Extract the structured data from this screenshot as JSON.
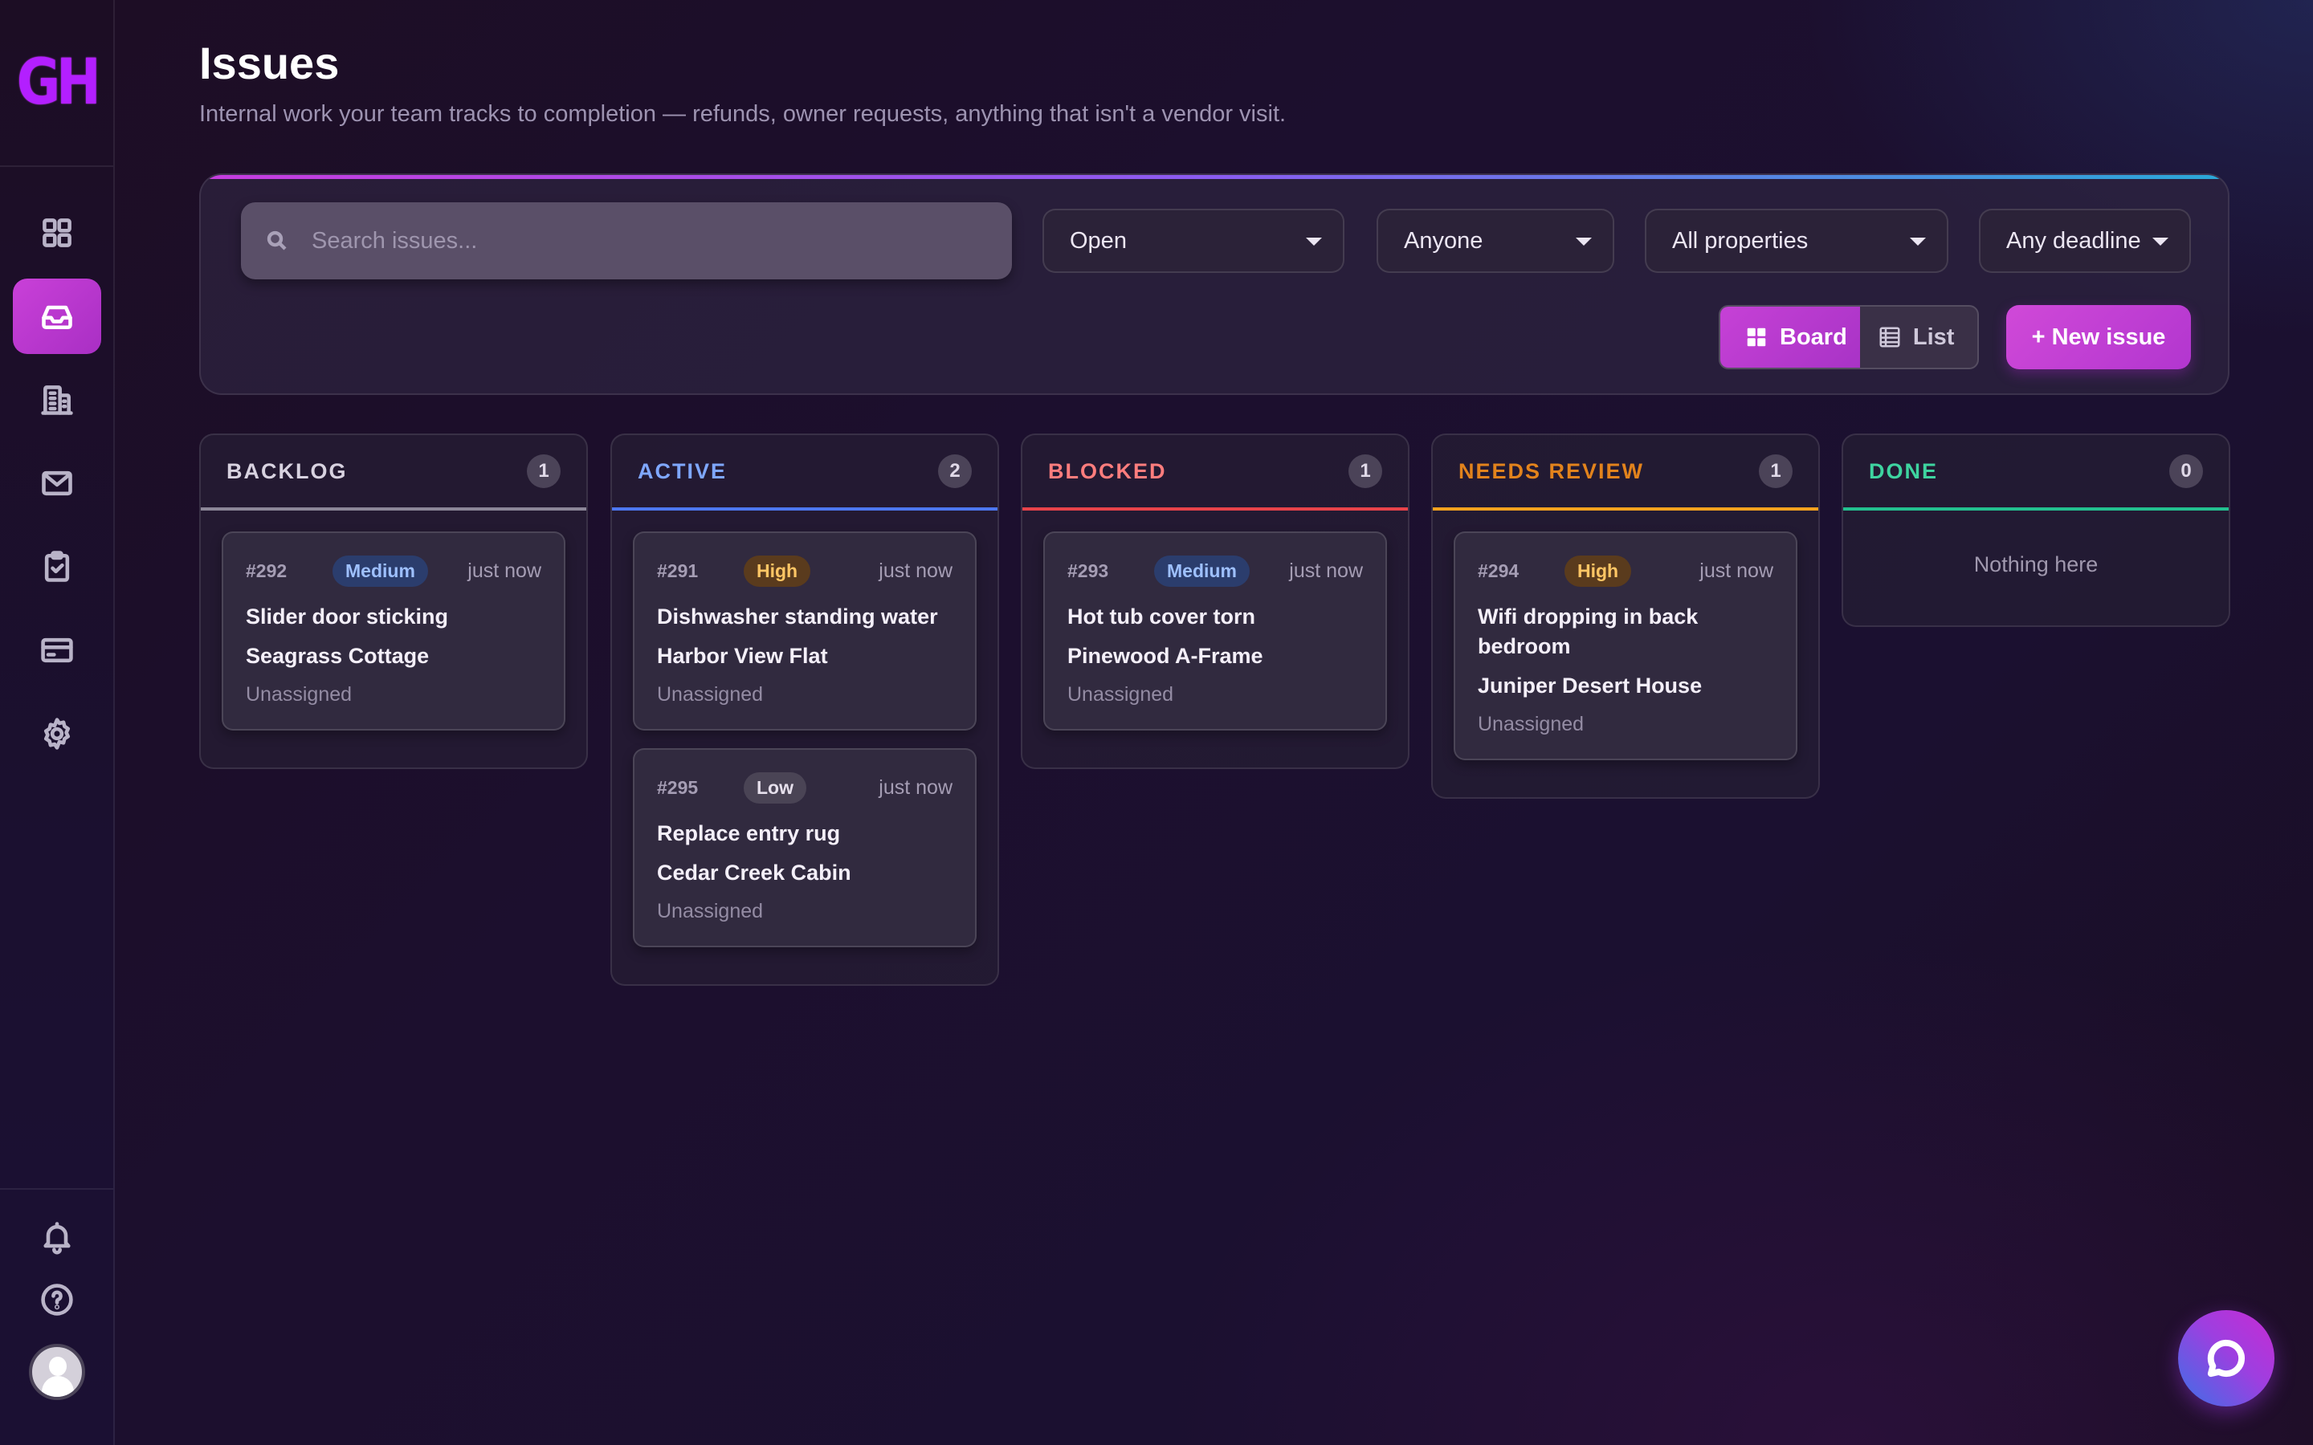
{
  "sidebar": {
    "logo_text": "GH",
    "nav": [
      {
        "name": "dashboard",
        "icon": "grid-icon"
      },
      {
        "name": "issues",
        "icon": "inbox-icon",
        "active": true
      },
      {
        "name": "properties",
        "icon": "building-icon"
      },
      {
        "name": "messages",
        "icon": "mail-icon"
      },
      {
        "name": "tasks",
        "icon": "clipboard-check-icon"
      },
      {
        "name": "billing",
        "icon": "credit-card-icon"
      },
      {
        "name": "settings",
        "icon": "gear-icon"
      }
    ],
    "bottom": [
      {
        "name": "notifications",
        "icon": "bell-icon"
      },
      {
        "name": "help",
        "icon": "help-circle-icon"
      }
    ]
  },
  "header": {
    "title": "Issues",
    "subtitle": "Internal work your team tracks to completion — refunds, owner requests, anything that isn't a vendor visit."
  },
  "filters": {
    "search_placeholder": "Search issues...",
    "status": "Open",
    "assignee": "Anyone",
    "property": "All properties",
    "deadline": "Any deadline"
  },
  "view_toggle": {
    "board": "Board",
    "list": "List",
    "active": "board"
  },
  "new_issue_label": "+ New issue",
  "columns": [
    {
      "title": "BACKLOG",
      "count": "1",
      "color": "#d8d2e0",
      "border": "#8c8698",
      "cards": [
        {
          "id": "#292",
          "priority": "Medium",
          "time": "just now",
          "title": "Slider door sticking",
          "property": "Seagrass Cottage",
          "assignee": "Unassigned"
        }
      ]
    },
    {
      "title": "ACTIVE",
      "count": "2",
      "color": "#7fa7ff",
      "border": "#4d77f0",
      "cards": [
        {
          "id": "#291",
          "priority": "High",
          "time": "just now",
          "title": "Dishwasher standing water",
          "property": "Harbor View Flat",
          "assignee": "Unassigned"
        },
        {
          "id": "#295",
          "priority": "Low",
          "time": "just now",
          "title": "Replace entry rug",
          "property": "Cedar Creek Cabin",
          "assignee": "Unassigned"
        }
      ]
    },
    {
      "title": "BLOCKED",
      "count": "1",
      "color": "#ff7d7d",
      "border": "#e8434a",
      "cards": [
        {
          "id": "#293",
          "priority": "Medium",
          "time": "just now",
          "title": "Hot tub cover torn",
          "property": "Pinewood A-Frame",
          "assignee": "Unassigned"
        }
      ]
    },
    {
      "title": "NEEDS REVIEW",
      "count": "1",
      "color": "#e2831c",
      "border": "#f4a21e",
      "cards": [
        {
          "id": "#294",
          "priority": "High",
          "time": "just now",
          "title": "Wifi dropping in back bedroom",
          "property": "Juniper Desert House",
          "assignee": "Unassigned"
        }
      ]
    },
    {
      "title": "DONE",
      "count": "0",
      "color": "#3ed4a0",
      "border": "#23c08f",
      "cards": [],
      "empty_text": "Nothing here"
    }
  ]
}
